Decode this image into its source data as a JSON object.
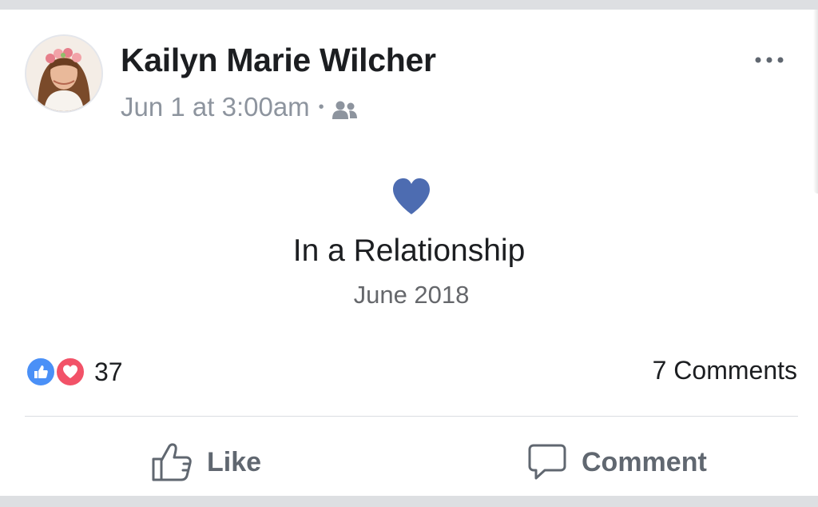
{
  "post": {
    "author": "Kailyn Marie Wilcher",
    "timestamp": "Jun 1 at 3:00am",
    "separator": "•",
    "audience_icon": "friends-icon",
    "more_icon": "more-options-icon"
  },
  "life_event": {
    "icon": "heart-icon",
    "title": "In a Relationship",
    "date": "June 2018"
  },
  "stats": {
    "reaction_icons": [
      "like-reaction-icon",
      "love-reaction-icon"
    ],
    "reaction_count": "37",
    "comments": "7 Comments"
  },
  "actions": {
    "like_label": "Like",
    "comment_label": "Comment"
  },
  "colors": {
    "heart": "#4d6cb1",
    "like_reaction": "#4a90f7",
    "love_reaction": "#f25268",
    "meta_text": "#8d949e",
    "action_text": "#606770"
  }
}
